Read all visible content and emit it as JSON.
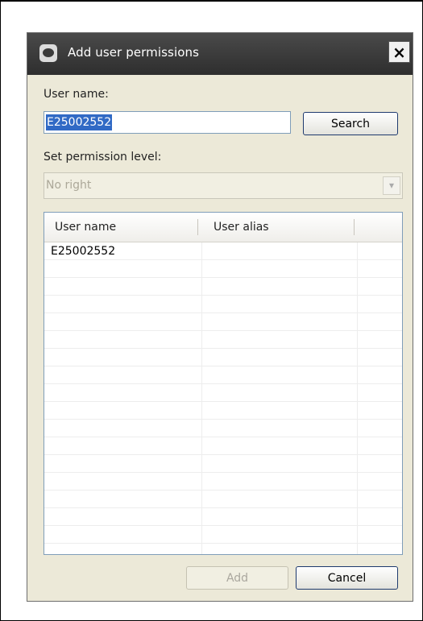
{
  "dialog": {
    "title": "Add user permissions",
    "close_label": "×"
  },
  "form": {
    "username_label": "User name:",
    "username_value": "E25002552",
    "search_label": "Search",
    "permission_label": "Set permission level:",
    "permission_value": "No right"
  },
  "table": {
    "columns": [
      "User name",
      "User alias"
    ],
    "rows": [
      [
        "E25002552",
        ""
      ]
    ]
  },
  "buttons": {
    "add_label": "Add",
    "cancel_label": "Cancel"
  }
}
